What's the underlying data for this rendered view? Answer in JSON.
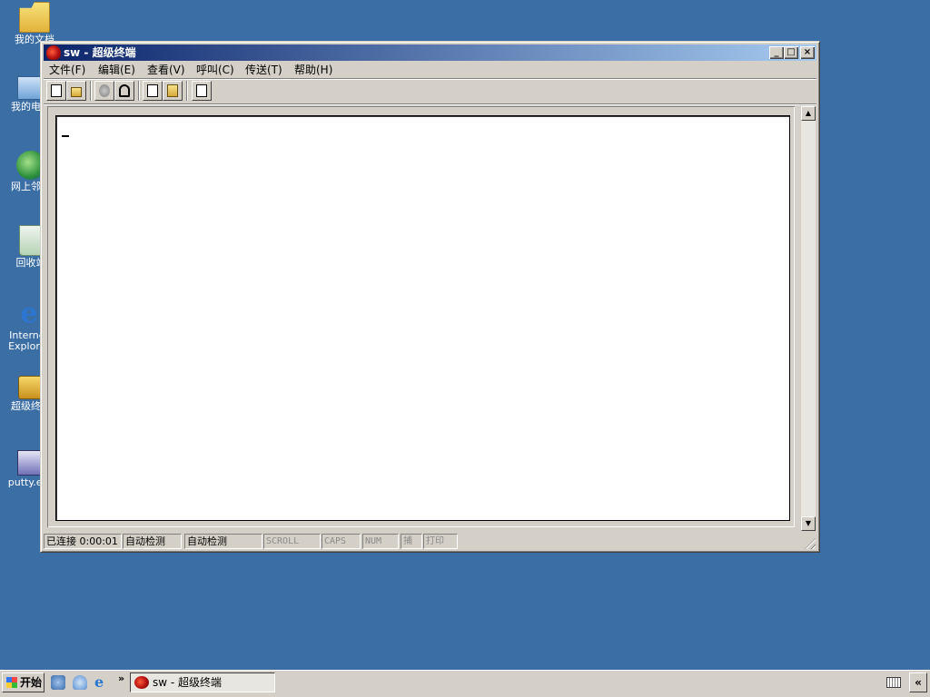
{
  "desktop": {
    "icons": [
      {
        "label": "我的文档",
        "icon": "my-documents-icon"
      },
      {
        "label": "我的电脑",
        "icon": "my-computer-icon"
      },
      {
        "label": "网上邻居",
        "icon": "network-places-icon"
      },
      {
        "label": "回收站",
        "icon": "recycle-bin-icon"
      },
      {
        "label": "Internet Explorer",
        "icon": "internet-explorer-icon"
      },
      {
        "label": "超级终端",
        "icon": "hyperterminal-shortcut-icon"
      },
      {
        "label": "putty.exe",
        "icon": "putty-icon"
      }
    ]
  },
  "window": {
    "title": "sw - 超级终端",
    "controls": {
      "minimize": "_",
      "maximize": "□",
      "close": "×"
    },
    "menu": [
      "文件(F)",
      "编辑(E)",
      "查看(V)",
      "呼叫(C)",
      "传送(T)",
      "帮助(H)"
    ],
    "toolbar": [
      "new-icon",
      "open-icon",
      "disconnect-icon",
      "call-icon",
      "send-icon",
      "receive-icon",
      "properties-icon"
    ],
    "statusbar": {
      "connected": "已连接 0:00:01",
      "detect1": "自动检测",
      "detect2": "自动检测",
      "scroll": "SCROLL",
      "caps": "CAPS",
      "num": "NUM",
      "capture": "捕",
      "print": "打印"
    }
  },
  "taskbar": {
    "start": "开始",
    "quick_launch": [
      "show-desktop-icon",
      "network-icon",
      "internet-explorer-icon"
    ],
    "chevron": "»",
    "active_task": "sw - 超级终端",
    "tray_expand": "«"
  },
  "colors": {
    "desktop": "#3a6ea5",
    "title_active_start": "#0a246a",
    "title_active_end": "#a6caf0",
    "face": "#d4d0c8"
  }
}
